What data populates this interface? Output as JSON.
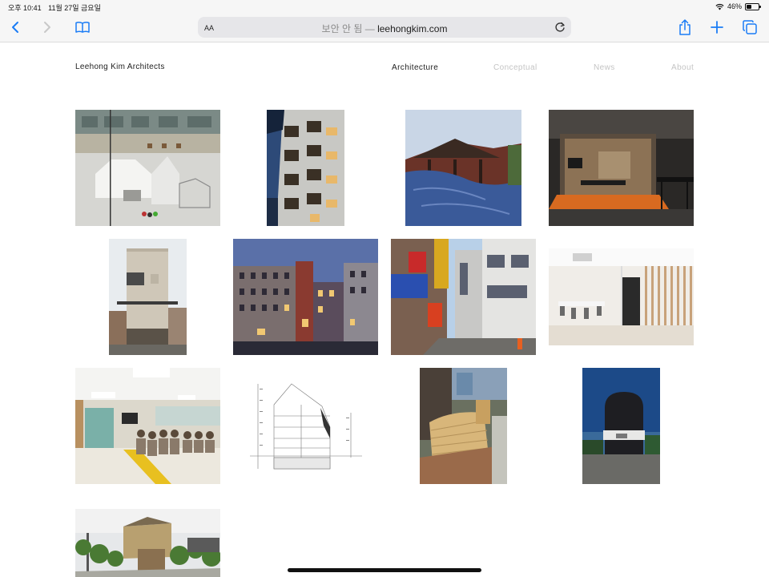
{
  "status_bar": {
    "time": "오후 10:41",
    "date": "11월 27일 금요일",
    "battery": "46%",
    "battery_level": 0.46
  },
  "browser": {
    "text_size_label": "AA",
    "address_security": "보안 안 됨 —",
    "address_domain": "leehongkim.com",
    "icons": {
      "back": "chevron-left-icon",
      "forward": "chevron-right-icon",
      "bookmarks": "book-icon",
      "reload": "reload-icon",
      "share": "share-icon",
      "new_tab": "plus-icon",
      "tabs": "tabs-icon"
    },
    "accent_color": "#1a7cf5"
  },
  "site": {
    "logo": "Leehong Kim Architects",
    "nav": [
      {
        "label": "Architecture",
        "active": true
      },
      {
        "label": "Conceptual",
        "active": false
      },
      {
        "label": "News",
        "active": false
      },
      {
        "label": "About",
        "active": false
      }
    ]
  },
  "projects": [
    {
      "subject": "library-interior"
    },
    {
      "subject": "apartment-facade"
    },
    {
      "subject": "wood-house-tarp"
    },
    {
      "subject": "glass-meeting-room"
    },
    {
      "subject": "white-tower-building"
    },
    {
      "subject": "brownstone-street-night"
    },
    {
      "subject": "korean-street-signs"
    },
    {
      "subject": "white-office-interior"
    },
    {
      "subject": "senior-center-lounge"
    },
    {
      "subject": "section-drawing"
    },
    {
      "subject": "wood-bench-street"
    },
    {
      "subject": "round-black-building"
    },
    {
      "subject": "garden-pavilion"
    }
  ]
}
